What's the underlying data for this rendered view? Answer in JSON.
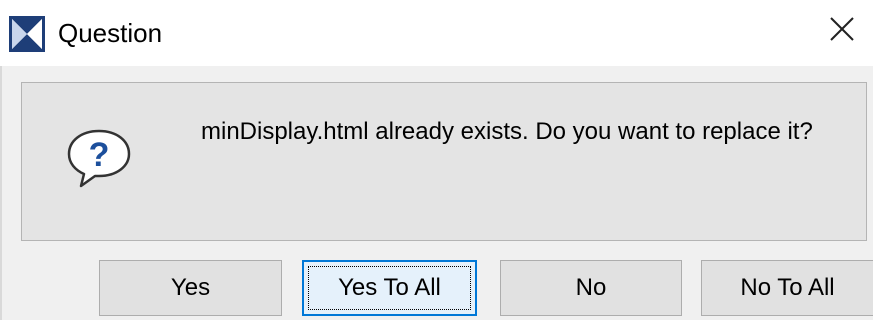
{
  "window": {
    "title": "Question",
    "icons": {
      "app": "app-logo-icon",
      "close": "close-icon",
      "dialog": "question-icon"
    },
    "colors": {
      "focus_border": "#0078d7",
      "icon_blue": "#1e3e78"
    }
  },
  "message": {
    "text": "minDisplay.html already exists. Do you want to replace it?"
  },
  "buttons": {
    "yes": "Yes",
    "yes_to_all": "Yes To All",
    "no": "No",
    "no_to_all": "No To All"
  }
}
